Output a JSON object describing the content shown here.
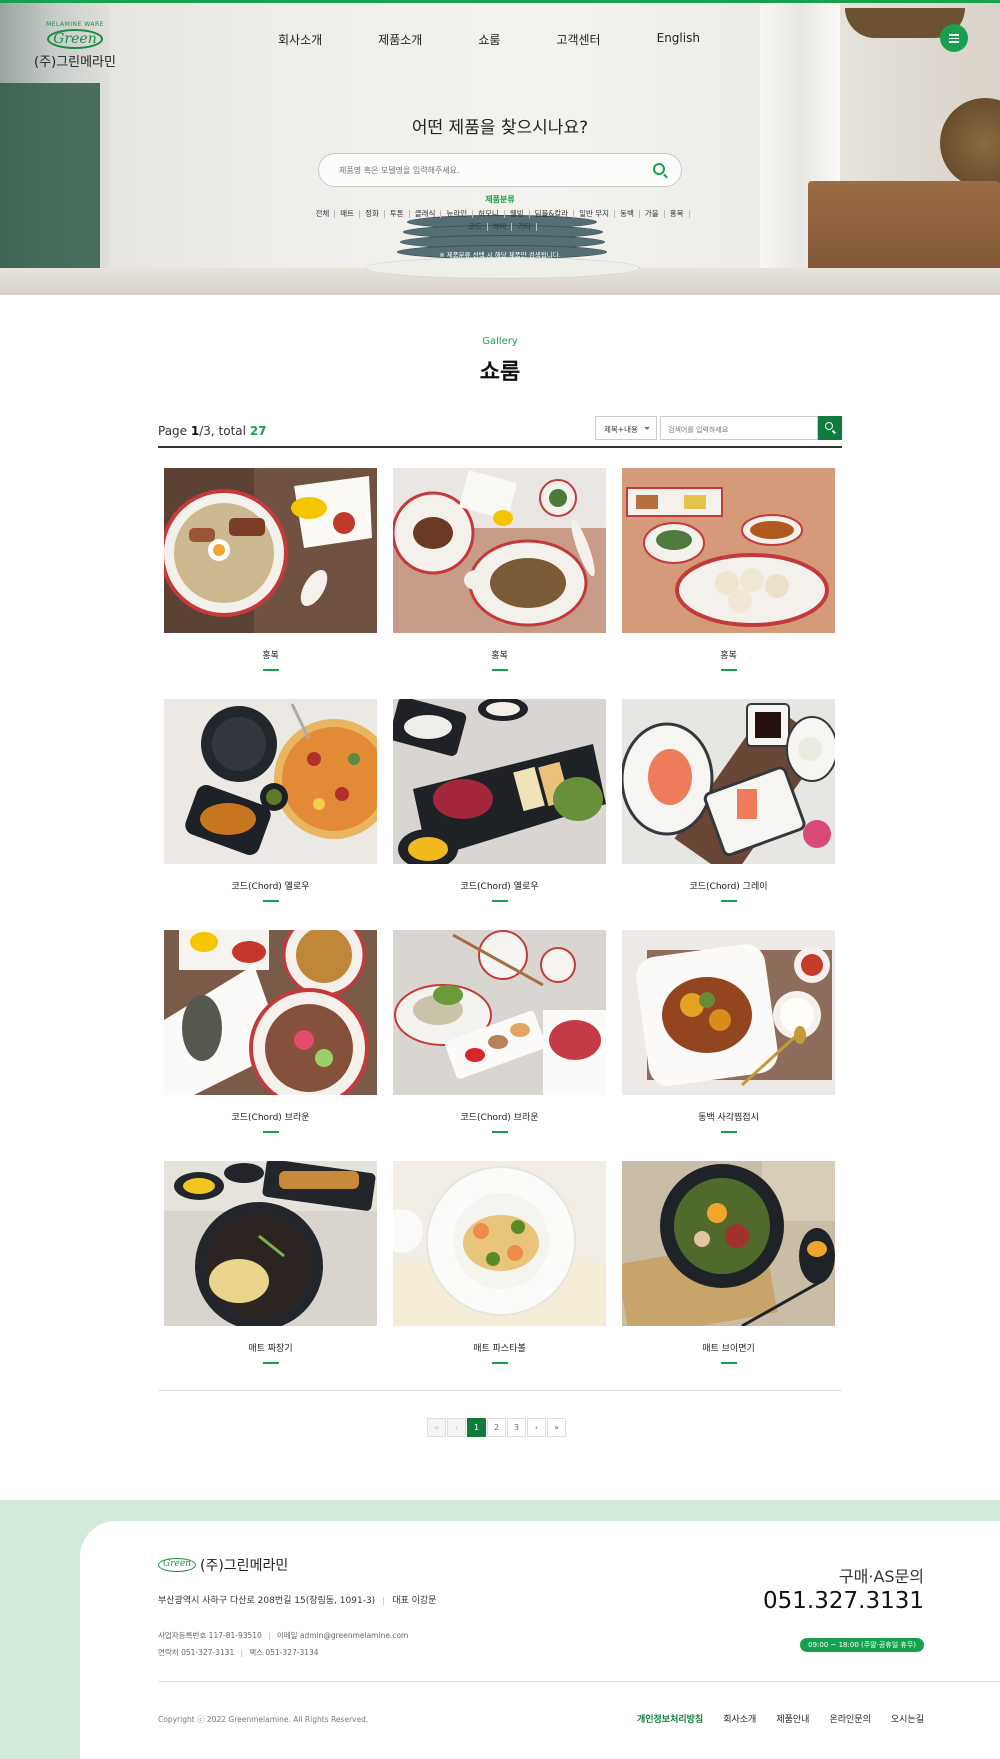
{
  "brand": {
    "logo_tagline": "MELAMINE WARE",
    "logo_word": "Green",
    "company_name": "(주)그린메라민"
  },
  "nav": {
    "items": [
      "회사소개",
      "제품소개",
      "쇼룸",
      "고객센터",
      "English"
    ]
  },
  "hero_search": {
    "title": "어떤 제품을 찾으시나요?",
    "placeholder": "제품명 혹은 모델명을 입력해주세요.",
    "category_label": "제품분류",
    "categories": [
      "전체",
      "매트",
      "정화",
      "투톤",
      "클래식",
      "뉴라인",
      "허모니",
      "웰빙",
      "딤플&칼라",
      "일반 무지",
      "동백",
      "가을",
      "홍복",
      "코드",
      "하비",
      "기타"
    ],
    "note": "※ 제품분류 선택 시 해당 제품만 검색됩니다."
  },
  "section": {
    "subtitle": "Gallery",
    "title": "쇼룸"
  },
  "list": {
    "page_label": "Page",
    "current_page": "1",
    "total_pages": "/3, total",
    "total_count": "27",
    "filter_selected": "제목+내용",
    "search_placeholder": "검색어를 입력하세요"
  },
  "gallery": {
    "items": [
      {
        "caption": "홍복",
        "image": "ramen-bowl-photo"
      },
      {
        "caption": "홍복",
        "image": "noodle-plate-photo"
      },
      {
        "caption": "홍복",
        "image": "dim-sum-photo"
      },
      {
        "caption": "코드(Chord) 옐로우",
        "image": "pizza-pasta-photo"
      },
      {
        "caption": "코드(Chord) 옐로우",
        "image": "beef-tartare-photo"
      },
      {
        "caption": "코드(Chord) 그레이",
        "image": "sashimi-photo"
      },
      {
        "caption": "코드(Chord) 브라운",
        "image": "rice-ball-photo"
      },
      {
        "caption": "코드(Chord) 브라운",
        "image": "shabu-photo"
      },
      {
        "caption": "동백 사각찜접시",
        "image": "braised-dish-photo"
      },
      {
        "caption": "매트 짜장기",
        "image": "jajangmyeon-photo"
      },
      {
        "caption": "매트 파스타볼",
        "image": "shrimp-pasta-photo"
      },
      {
        "caption": "매트 브이면기",
        "image": "bibim-noodle-photo"
      }
    ]
  },
  "pager": {
    "first": "«",
    "prev": "‹",
    "pages": [
      "1",
      "2",
      "3"
    ],
    "current": "1",
    "next": "›",
    "last": "»"
  },
  "footer": {
    "company_name": "(주)그린메라민",
    "address": "부산광역시 사하구 다산로 208번길 15(장림동, 1091-3)",
    "ceo": "대표 이강문",
    "biz_no": "사업자등록번호 117-81-93510",
    "email": "이메일 admin@greenmelamine.com",
    "phone": "연락처 051-327-3131",
    "fax": "팩스 051-327-3134",
    "cs_label": "구매·AS문의",
    "cs_phone": "051.327.3131",
    "hours": "09:00 ~ 18:00 (주말·공휴일 휴무)",
    "copyright": "Copyright ⓒ 2022 Greenmelamine. All Rights Reserved.",
    "links": [
      "개인정보처리방침",
      "회사소개",
      "제품안내",
      "온라인문의",
      "오시는길"
    ]
  },
  "colors": {
    "accent": "#17a14f",
    "dark_green": "#0f7c3d",
    "footer_bg": "#d3eadb"
  }
}
